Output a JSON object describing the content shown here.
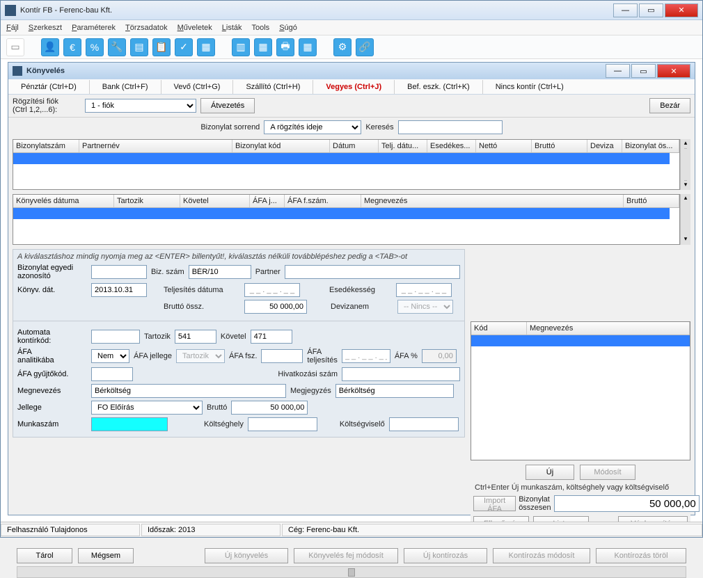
{
  "app": {
    "title": "Kontír FB  - Ferenc-bau Kft."
  },
  "menu": {
    "file": "Fájl",
    "edit": "Szerkeszt",
    "params": "Paraméterek",
    "master": "Törzsadatok",
    "ops": "Műveletek",
    "lists": "Listák",
    "tools": "Tools",
    "help": "Súgó"
  },
  "inner": {
    "title": "Könyvelés"
  },
  "tabs": {
    "cash": "Pénztár (Ctrl+D)",
    "bank": "Bank (Ctrl+F)",
    "cust": "Vevő (Ctrl+G)",
    "supp": "Szállító (Ctrl+H)",
    "mixed": "Vegyes (Ctrl+J)",
    "asset": "Bef. eszk. (Ctrl+K)",
    "none": "Nincs kontír (Ctrl+L)"
  },
  "fixrow": {
    "label": "Rögzítési fiók\n(Ctrl 1,2,...6):",
    "value": "1 - fiók",
    "btn": "Átvezetés",
    "close": "Bezár"
  },
  "sort": {
    "label": "Bizonylat sorrend",
    "value": "A rögzítés ideje",
    "search": "Keresés"
  },
  "grid1": {
    "h": [
      "Bizonylatszám",
      "Partnernév",
      "Bizonylat kód",
      "Dátum",
      "Telj. dátu...",
      "Esedékes...",
      "Nettó",
      "Bruttó",
      "Deviza",
      "Bizonylat ös..."
    ]
  },
  "grid2": {
    "h": [
      "Könyvelés dátuma",
      "Tartozik",
      "Követel",
      "ÁFA j...",
      "ÁFA f.szám.",
      "Megnevezés",
      "Bruttó"
    ]
  },
  "mid": {
    "hint": "A kiválasztáshoz mindig nyomja meg az <ENTER> billentyűt!, kiválasztás nélküli továbblépéshez pedig a <TAB>-ot",
    "biz_azon_l": "Bizonylat egyedi\nazonosító",
    "biz_szam_l": "Biz. szám",
    "biz_szam": "BÉR/10",
    "partner_l": "Partner",
    "konyv_dat_l": "Könyv. dát.",
    "konyv_dat": "2013.10.31",
    "telj_l": "Teljesítés dátuma",
    "telj": "_ _ . _ _ . _ _",
    "esed_l": "Esedékesség",
    "esed": "_ _ . _ _ . _ _",
    "brutto_l": "Bruttó össz.",
    "brutto": "50 000,00",
    "deviza_l": "Devizanem",
    "deviza": "-- Nincs --",
    "auto_l": "Automata\nkontírkód:",
    "tartozik_l": "Tartozik",
    "tartozik": "541",
    "kovetel_l": "Követel",
    "kovetel": "471",
    "afa_anal_l": "ÁFA\nanalitikába",
    "afa_anal": "Nem",
    "afa_jel_l": "ÁFA jellege",
    "afa_jel": "Tartozik",
    "afa_fsz_l": "ÁFA fsz.",
    "afa_telj_l": "ÁFA\nteljesítés",
    "afa_telj": "_ _ . _ _ . _ _",
    "afa_pct_l": "ÁFA %",
    "afa_pct": "0,00",
    "afa_gyujto_l": "ÁFA gyűjtőkód.",
    "hiv_l": "Hivatkozási szám",
    "megn_l": "Megnevezés",
    "megn": "Bérköltség",
    "megj_l": "Megjegyzés",
    "megj": "Bérköltség",
    "jellege_l": "Jellege",
    "jellege": "FO Előírás",
    "brutto2_l": "Bruttó",
    "brutto2": "50 000,00",
    "munkaszam_l": "Munkaszám",
    "koltseghely_l": "Költséghely",
    "koltsegviselo_l": "Költségviselő"
  },
  "rbox": {
    "h": [
      "Kód",
      "Megnevezés"
    ],
    "uj": "Új",
    "modosit": "Módosít",
    "hint": "Ctrl+Enter Új munkaszám, költséghely vagy költségviselő",
    "import": "Import ÁFA",
    "biz_ossz_l": "Bizonylat\nösszesen",
    "biz_ossz": "50 000,00",
    "ellen": "Ellenőrzés",
    "lista": "Lista",
    "vegleg": "Véglegesítés"
  },
  "actions": {
    "tarol": "Tárol",
    "megsem": "Mégsem",
    "uj_konyv": "Új könyvelés",
    "fej_mod": "Könyvelés fej módosít",
    "uj_kontir": "Új kontírozás",
    "kontir_mod": "Kontírozás módosít",
    "kontir_torol": "Kontírozás töröl"
  },
  "status": {
    "user": "Felhasználó Tulajdonos",
    "period": "Időszak: 2013",
    "ceg": "Cég: Ferenc-bau Kft."
  }
}
